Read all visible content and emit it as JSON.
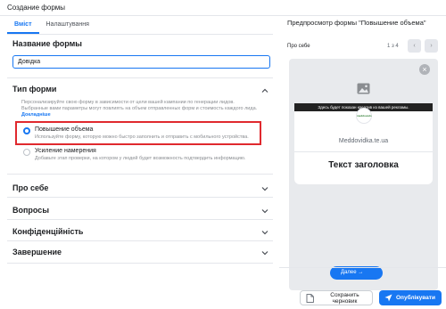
{
  "window": {
    "title": "Создание формы"
  },
  "tabs": [
    {
      "label": "Вміст",
      "active": true
    },
    {
      "label": "Налаштування",
      "active": false
    }
  ],
  "name_field": {
    "title": "Название формы",
    "value": "Довідка"
  },
  "form_type": {
    "title": "Тип форми",
    "description": "Персонализируйте свою форму в зависимости от цели вашей кампании по генерации лидов. Выбранные вами параметры могут повлиять на объем отправленных форм и стоимость каждого лида.",
    "learn_more": "Докладніше",
    "options": [
      {
        "title": "Повышение объема",
        "description": "Используйте форму, которую можно быстро заполнить и отправить с мобильного устройства.",
        "selected": true
      },
      {
        "title": "Усиление намерения",
        "description": "Добавьте этап проверки, на котором у людей будет возможность подтвердить информацию.",
        "selected": false
      }
    ]
  },
  "sections": [
    {
      "title": "Про себе"
    },
    {
      "title": "Вопросы"
    },
    {
      "title": "Конфіденційність"
    },
    {
      "title": "Завершение"
    }
  ],
  "preview": {
    "title": "Предпросмотр формы \"Повышение объема\"",
    "step_label": "Про себе",
    "counter": "1 з 4",
    "banner": "Здесь будет показан креатив из вашей рекламы.",
    "logo_text": "meddoveds",
    "domain": "Meddovidka.te.ua",
    "headline": "Текст заголовка",
    "next_button": "Далее"
  },
  "footer": {
    "save_draft": "Сохранить черновик",
    "publish": "Опублікувати"
  },
  "colors": {
    "accent": "#1877f2",
    "highlight": "#e0292e"
  }
}
